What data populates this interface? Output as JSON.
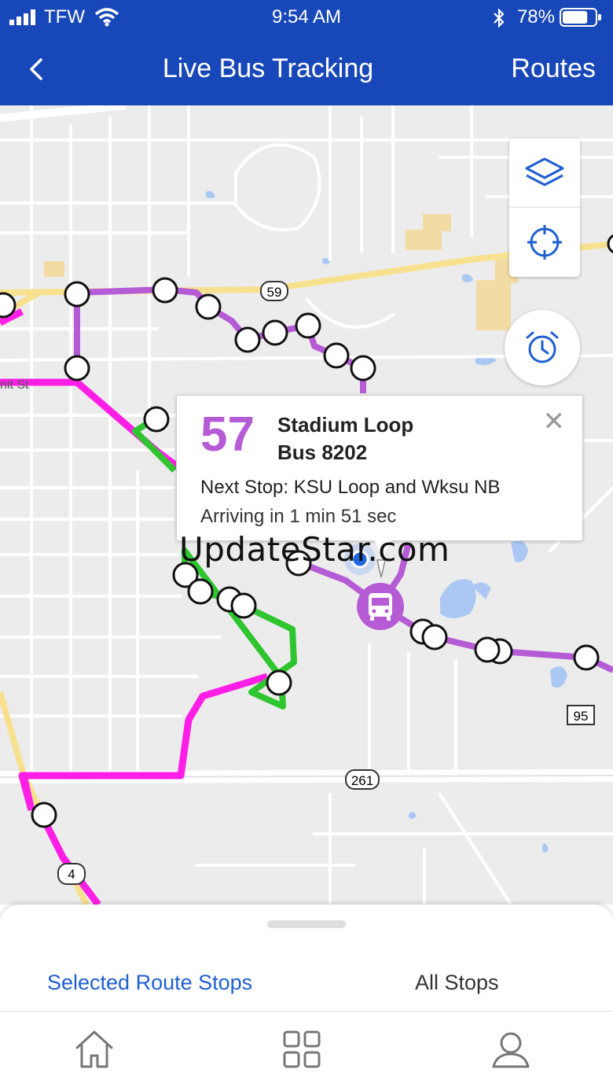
{
  "status_bar": {
    "carrier": "TFW",
    "time": "9:54 AM",
    "battery_percent": "78%",
    "battery_level": 0.78,
    "icons": [
      "signal-icon",
      "wifi-icon",
      "bluetooth-icon",
      "battery-icon"
    ]
  },
  "header": {
    "back_icon": "chevron-left-icon",
    "title": "Live Bus Tracking",
    "routes_label": "Routes"
  },
  "map": {
    "road_labels": [
      "59",
      "261",
      "95",
      "4"
    ],
    "street_fragment": "nit St",
    "route_colors": {
      "stadium_loop": "#b65bd6",
      "route_magenta": "#ff1ee6",
      "route_green": "#2fc52f"
    },
    "controls": [
      "layers-icon",
      "locate-icon",
      "alarm-clock-icon"
    ],
    "bus_marker_icon": "bus-icon"
  },
  "popup": {
    "route_number": "57",
    "route_name": "Stadium Loop",
    "bus": "Bus 8202",
    "next_stop": "Next Stop: KSU Loop and Wksu NB",
    "arriving": "Arriving in 1 min 51 sec",
    "close_icon": "close-icon"
  },
  "watermark": "UpdateStar.com",
  "bottom_sheet": {
    "tabs": [
      {
        "label": "Selected Route Stops",
        "selected": true
      },
      {
        "label": "All Stops",
        "selected": false
      }
    ]
  },
  "tab_bar": {
    "icons": [
      "home-icon",
      "grid-icon",
      "profile-icon"
    ]
  }
}
